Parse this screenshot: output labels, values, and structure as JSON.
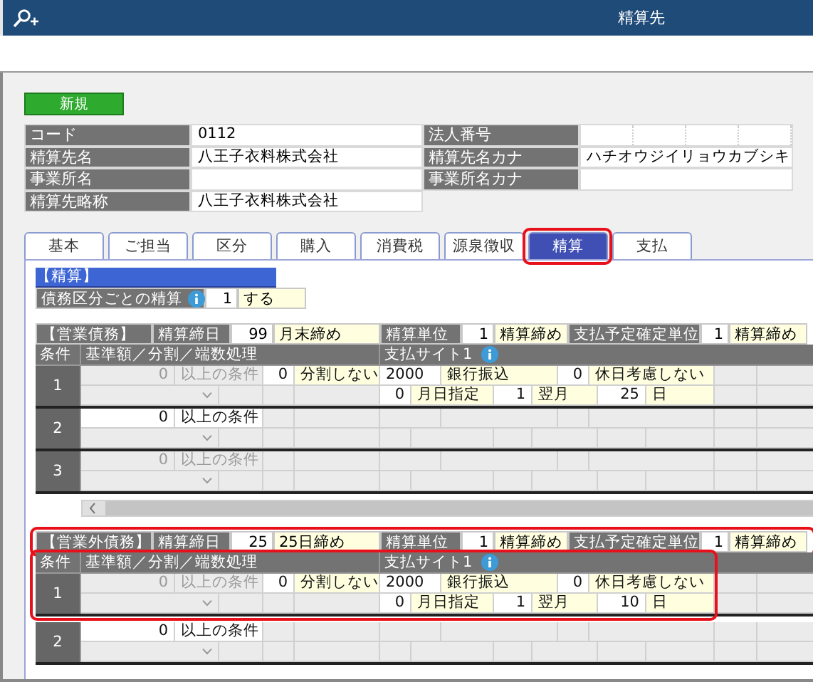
{
  "window": {
    "title": "精算先"
  },
  "new_button": "新規",
  "info_rows": [
    {
      "left": {
        "label": "コード",
        "value": "0112"
      },
      "right": {
        "label": "法人番号",
        "kind": "segmented"
      }
    },
    {
      "left": {
        "label": "精算先名",
        "value": "八王子衣料株式会社"
      },
      "right": {
        "label": "精算先名カナ",
        "value": "ハチオウジイリョウカブシキ"
      }
    },
    {
      "left": {
        "label": "事業所名"
      },
      "right": {
        "label": "事業所名カナ"
      }
    },
    {
      "left": {
        "label": "精算先略称",
        "value": "八王子衣料株式会社"
      }
    }
  ],
  "tabs": [
    {
      "label": "基本",
      "selected": false,
      "highlighted": false
    },
    {
      "label": "ご担当",
      "selected": false,
      "highlighted": false
    },
    {
      "label": "区分",
      "selected": false,
      "highlighted": false
    },
    {
      "label": "購入",
      "selected": false,
      "highlighted": false
    },
    {
      "label": "消費税",
      "selected": false,
      "highlighted": false
    },
    {
      "label": "源泉徴収",
      "selected": false,
      "highlighted": false
    },
    {
      "label": "精算",
      "selected": true,
      "highlighted": true
    },
    {
      "label": "支払",
      "selected": false,
      "highlighted": false
    }
  ],
  "settlement": {
    "title": "【精算】",
    "label": "債務区分ごとの精算",
    "code": "1",
    "value": "する"
  },
  "sections": [
    {
      "highlighted": false,
      "first_row_highlighted": false,
      "scrollbar": true,
      "header": [
        {
          "kind": "title",
          "text": "【営業債務】"
        },
        {
          "kind": "label",
          "text": "精算締日"
        },
        {
          "kind": "code",
          "text": "99"
        },
        {
          "kind": "value",
          "text": "月末締め"
        },
        {
          "kind": "label",
          "text": "精算単位"
        },
        {
          "kind": "code",
          "text": "1"
        },
        {
          "kind": "value",
          "text": "精算締め"
        },
        {
          "kind": "label",
          "text": "支払予定確定単位"
        },
        {
          "kind": "code",
          "text": "1"
        },
        {
          "kind": "value",
          "text": "精算締め"
        }
      ],
      "columns": {
        "condition": "条件",
        "basis": "基準額／分割／端数処理",
        "site": "支払サイト1"
      },
      "rows": [
        {
          "number": "1",
          "enabled": false,
          "amount": "0",
          "condition": "以上の条件",
          "split_code": "0",
          "split": "分割しない",
          "site_amount": "2000",
          "method": "銀行振込",
          "holiday_code": "0",
          "holiday": "休日考慮しない",
          "date_code": "0",
          "date_type": "月日指定",
          "month_code": "1",
          "month": "翌月",
          "day": "25",
          "day_unit": "日"
        },
        {
          "number": "2",
          "enabled": true,
          "amount": "0",
          "condition": "以上の条件"
        },
        {
          "number": "3",
          "enabled": false,
          "amount": "0",
          "condition": "以上の条件"
        }
      ]
    },
    {
      "highlighted": true,
      "first_row_highlighted": true,
      "scrollbar": false,
      "header": [
        {
          "kind": "title",
          "text": "【営業外債務】"
        },
        {
          "kind": "label",
          "text": "精算締日"
        },
        {
          "kind": "code",
          "text": "25"
        },
        {
          "kind": "value",
          "text": "25日締め"
        },
        {
          "kind": "label",
          "text": "精算単位"
        },
        {
          "kind": "code",
          "text": "1"
        },
        {
          "kind": "value",
          "text": "精算締め"
        },
        {
          "kind": "label",
          "text": "支払予定確定単位"
        },
        {
          "kind": "code",
          "text": "1"
        },
        {
          "kind": "value",
          "text": "精算締め"
        }
      ],
      "columns": {
        "condition": "条件",
        "basis": "基準額／分割／端数処理",
        "site": "支払サイト1"
      },
      "rows": [
        {
          "number": "1",
          "enabled": false,
          "amount": "0",
          "condition": "以上の条件",
          "split_code": "0",
          "split": "分割しない",
          "site_amount": "2000",
          "method": "銀行振込",
          "holiday_code": "0",
          "holiday": "休日考慮しない",
          "date_code": "0",
          "date_type": "月日指定",
          "month_code": "1",
          "month": "翌月",
          "day": "10",
          "day_unit": "日"
        },
        {
          "number": "2",
          "enabled": true,
          "amount": "0",
          "condition": "以上の条件"
        }
      ]
    }
  ]
}
